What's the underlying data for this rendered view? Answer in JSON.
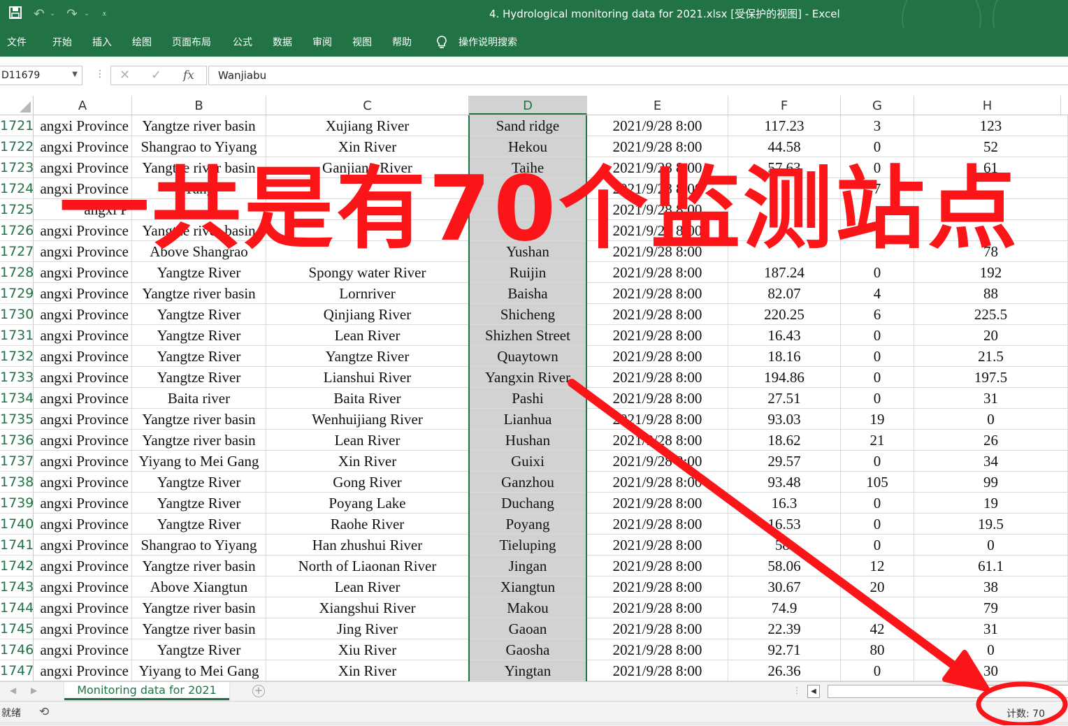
{
  "window": {
    "doc_title": "4. Hydrological monitoring data for 2021.xlsx  [受保护的视图]  -  Excel",
    "quick_access": {
      "save_icon": "save-icon",
      "undo_icon": "undo-icon",
      "redo_icon": "redo-icon",
      "customize_icon": "customize-icon"
    }
  },
  "ribbon": {
    "tabs": [
      "文件",
      "开始",
      "插入",
      "绘图",
      "页面布局",
      "公式",
      "数据",
      "审阅",
      "视图",
      "帮助"
    ],
    "search_label": "操作说明搜索"
  },
  "formula_bar": {
    "name_box": "D11679",
    "content": "Wanjiabu"
  },
  "columns": [
    "A",
    "B",
    "C",
    "D",
    "E",
    "F",
    "G",
    "H"
  ],
  "selected_column": "D",
  "rows": [
    {
      "n": "1721",
      "A": "angxi Province",
      "B": "Yangtze river basin",
      "C": "Xujiang River",
      "D": "Sand ridge",
      "E": "2021/9/28 8:00",
      "F": "117.23",
      "G": "3",
      "H": "123"
    },
    {
      "n": "1722",
      "A": "angxi Province",
      "B": "Shangrao to Yiyang",
      "C": "Xin River",
      "D": "Hekou",
      "E": "2021/9/28 8:00",
      "F": "44.58",
      "G": "0",
      "H": "52"
    },
    {
      "n": "1723",
      "A": "angxi Province",
      "B": "Yangtze river basin",
      "C": "Ganjiang River",
      "D": "Taihe",
      "E": "2021/9/28 8:00",
      "F": "57.63",
      "G": "0",
      "H": "61"
    },
    {
      "n": "1724",
      "A": "angxi Province",
      "B": "Yang",
      "C": "",
      "D": "",
      "E": "2021/9/28 8:00",
      "F": "",
      "G": "7",
      "H": ""
    },
    {
      "n": "1725",
      "A": "angxi P",
      "B": "",
      "C": "",
      "D": "",
      "E": "2021/9/28 8:00",
      "F": "",
      "G": "",
      "H": ""
    },
    {
      "n": "1726",
      "A": "angxi Province",
      "B": "Yangtze river basin",
      "C": "",
      "D": "",
      "E": "2021/9/28 8:00",
      "F": "",
      "G": "",
      "H": ""
    },
    {
      "n": "1727",
      "A": "angxi Province",
      "B": "Above Shangrao",
      "C": "",
      "D": "Yushan",
      "E": "2021/9/28 8:00",
      "F": "",
      "G": "",
      "H": "78"
    },
    {
      "n": "1728",
      "A": "angxi Province",
      "B": "Yangtze River",
      "C": "Spongy water River",
      "D": "Ruijin",
      "E": "2021/9/28 8:00",
      "F": "187.24",
      "G": "0",
      "H": "192"
    },
    {
      "n": "1729",
      "A": "angxi Province",
      "B": "Yangtze river basin",
      "C": "Lornriver",
      "D": "Baisha",
      "E": "2021/9/28 8:00",
      "F": "82.07",
      "G": "4",
      "H": "88"
    },
    {
      "n": "1730",
      "A": "angxi Province",
      "B": "Yangtze River",
      "C": "Qinjiang River",
      "D": "Shicheng",
      "E": "2021/9/28 8:00",
      "F": "220.25",
      "G": "6",
      "H": "225.5"
    },
    {
      "n": "1731",
      "A": "angxi Province",
      "B": "Yangtze River",
      "C": "Lean River",
      "D": "Shizhen Street",
      "E": "2021/9/28 8:00",
      "F": "16.43",
      "G": "0",
      "H": "20"
    },
    {
      "n": "1732",
      "A": "angxi Province",
      "B": "Yangtze River",
      "C": "Yangtze River",
      "D": "Quaytown",
      "E": "2021/9/28 8:00",
      "F": "18.16",
      "G": "0",
      "H": "21.5"
    },
    {
      "n": "1733",
      "A": "angxi Province",
      "B": "Yangtze River",
      "C": "Lianshui River",
      "D": "Yangxin River",
      "E": "2021/9/28 8:00",
      "F": "194.86",
      "G": "0",
      "H": "197.5"
    },
    {
      "n": "1734",
      "A": "angxi Province",
      "B": "Baita river",
      "C": "Baita River",
      "D": "Pashi",
      "E": "2021/9/28 8:00",
      "F": "27.51",
      "G": "0",
      "H": "31"
    },
    {
      "n": "1735",
      "A": "angxi Province",
      "B": "Yangtze river basin",
      "C": "Wenhuijiang River",
      "D": "Lianhua",
      "E": "2021/9/28 8:00",
      "F": "93.03",
      "G": "19",
      "H": "0"
    },
    {
      "n": "1736",
      "A": "angxi Province",
      "B": "Yangtze river basin",
      "C": "Lean River",
      "D": "Hushan",
      "E": "2021/9/28 8:00",
      "F": "18.62",
      "G": "21",
      "H": "26"
    },
    {
      "n": "1737",
      "A": "angxi Province",
      "B": "Yiyang to Mei Gang",
      "C": "Xin River",
      "D": "Guixi",
      "E": "2021/9/28 8:00",
      "F": "29.57",
      "G": "0",
      "H": "34"
    },
    {
      "n": "1738",
      "A": "angxi Province",
      "B": "Yangtze River",
      "C": "Gong River",
      "D": "Ganzhou",
      "E": "2021/9/28 8:00",
      "F": "93.48",
      "G": "105",
      "H": "99"
    },
    {
      "n": "1739",
      "A": "angxi Province",
      "B": "Yangtze River",
      "C": "Poyang Lake",
      "D": "Duchang",
      "E": "2021/9/28 8:00",
      "F": "16.3",
      "G": "0",
      "H": "19"
    },
    {
      "n": "1740",
      "A": "angxi Province",
      "B": "Yangtze River",
      "C": "Raohe River",
      "D": "Poyang",
      "E": "2021/9/28 8:00",
      "F": "16.53",
      "G": "0",
      "H": "19.5"
    },
    {
      "n": "1741",
      "A": "angxi Province",
      "B": "Shangrao to Yiyang",
      "C": "Han zhushui River",
      "D": "Tieluping",
      "E": "2021/9/28 8:00",
      "F": "58.",
      "G": "0",
      "H": "0"
    },
    {
      "n": "1742",
      "A": "angxi Province",
      "B": "Yangtze river basin",
      "C": "North of Liaonan River",
      "D": "Jingan",
      "E": "2021/9/28 8:00",
      "F": "58.06",
      "G": "12",
      "H": "61.1"
    },
    {
      "n": "1743",
      "A": "angxi Province",
      "B": "Above Xiangtun",
      "C": "Lean River",
      "D": "Xiangtun",
      "E": "2021/9/28 8:00",
      "F": "30.67",
      "G": "20",
      "H": "38"
    },
    {
      "n": "1744",
      "A": "angxi Province",
      "B": "Yangtze river basin",
      "C": "Xiangshui River",
      "D": "Makou",
      "E": "2021/9/28 8:00",
      "F": "74.9",
      "G": "",
      "H": "79"
    },
    {
      "n": "1745",
      "A": "angxi Province",
      "B": "Yangtze river basin",
      "C": "Jing River",
      "D": "Gaoan",
      "E": "2021/9/28 8:00",
      "F": "22.39",
      "G": "42",
      "H": "31"
    },
    {
      "n": "1746",
      "A": "angxi Province",
      "B": "Yangtze River",
      "C": "Xiu River",
      "D": "Gaosha",
      "E": "2021/9/28 8:00",
      "F": "92.71",
      "G": "80",
      "H": "0"
    },
    {
      "n": "1747",
      "A": "angxi Province",
      "B": "Yiyang to Mei Gang",
      "C": "Xin River",
      "D": "Yingtan",
      "E": "2021/9/28 8:00",
      "F": "26.36",
      "G": "0",
      "H": "30"
    }
  ],
  "sheet_tabs": [
    "Monitoring data for 2021"
  ],
  "status": {
    "ready": "就绪",
    "count": "计数: 70"
  },
  "annotation": {
    "overlay_text": "一共是有70个监测站点",
    "color": "#fb1418"
  },
  "colors": {
    "excel_green": "#217346",
    "selected_column_fill": "#d2d2d2"
  }
}
